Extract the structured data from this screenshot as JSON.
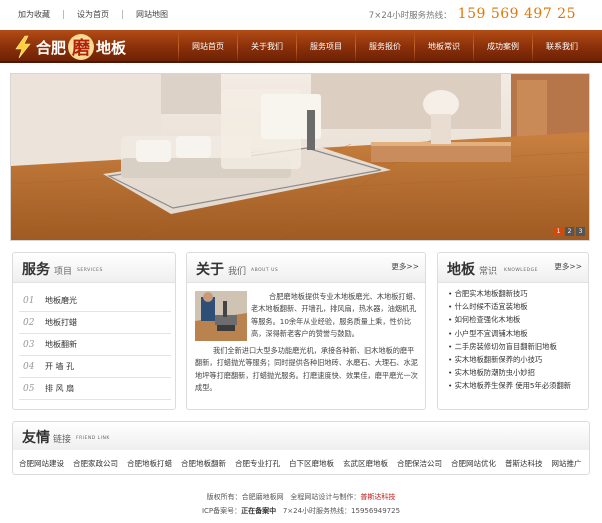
{
  "top_links": [
    "加为收藏",
    "设为首页",
    "网站地图"
  ],
  "hotline": {
    "label": "7×24小时服务热线：",
    "number": "159 569 497 25"
  },
  "logo": {
    "part1": "合肥",
    "part2": "磨",
    "part3": "地板"
  },
  "nav": [
    "网站首页",
    "关于我们",
    "服务项目",
    "服务报价",
    "地板常识",
    "成功案例",
    "联系我们"
  ],
  "banner_dots": [
    "1",
    "2",
    "3"
  ],
  "services": {
    "title": "服务",
    "subtitle": "项目",
    "en": "SERVICES",
    "items": [
      {
        "num": "01",
        "label": "地板磨光"
      },
      {
        "num": "02",
        "label": "地板打蜡"
      },
      {
        "num": "03",
        "label": "地板翻新"
      },
      {
        "num": "04",
        "label": "开 墙 孔"
      },
      {
        "num": "05",
        "label": "排 风 扇"
      }
    ]
  },
  "about": {
    "title": "关于",
    "subtitle": "我们",
    "en": "ABOUT US",
    "more": "更多>>",
    "p1": "合肥磨地板提供专业木地板磨光、木地板打蜡、老木地板翻新、开墙孔，排风扇，热水器，油烟机孔等服务。10余年从业经验，服务质量上乘，性价比高，深得新老客户的赞誉与鼓励。",
    "p2": "我们全新进口大型多功能磨光机，承接各种新、旧木地板的磨平翻新，打蜡抛光等服务；同时提供各种旧地砖、水磨石、大理石、水泥地坪等打磨翻新，打蜡抛光服务。打磨速度快、效果佳，磨平磨光一次成型。"
  },
  "knowledge": {
    "title": "地板",
    "subtitle": "常识",
    "en": "KNOWLEDGE",
    "more": "更多>>",
    "items": [
      "合肥实木地板翻新技巧",
      "什么时候不适宜装地板",
      "如何检查强化木地板",
      "小户型不宜调铺木地板",
      "二手房装修切勿盲目翻新旧地板",
      "实木地板翻新保养的小技巧",
      "实木地板防潮防虫小妙招",
      "实木地板养生保养 使用5年必须翻新"
    ]
  },
  "friend": {
    "title": "友情",
    "subtitle": "链接",
    "en": "FRIEND LINK",
    "links": [
      "合肥网站建设",
      "合肥家政公司",
      "合肥地板打蜡",
      "合肥地板翻新",
      "合肥专业打孔",
      "白下区磨地板",
      "玄武区磨地板",
      "合肥保洁公司",
      "合肥网站优化",
      "普斯达科技",
      "网站推广"
    ]
  },
  "footer": {
    "copyright_label": "版权所有：",
    "copyright_value": "合肥磨地板网",
    "design_label": "全程网站设计与制作：",
    "design_value": "普斯达科技",
    "icp_label": "ICP备案号：",
    "icp_value": "正在备案中",
    "hotline_text": "7×24小时服务热线：15956949725"
  },
  "colors": {
    "nav_bg": "#8a300a",
    "hotline": "#e07808",
    "accent_red": "#c3170e"
  }
}
